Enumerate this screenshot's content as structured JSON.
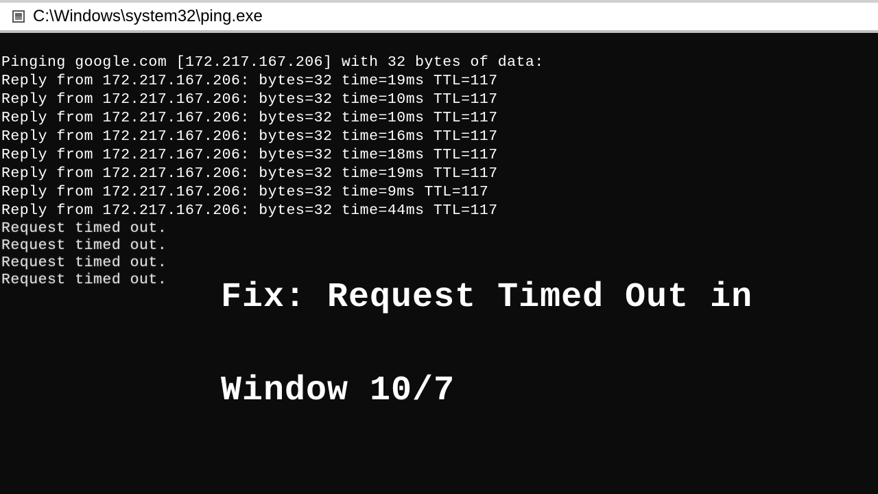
{
  "window": {
    "title": "C:\\Windows\\system32\\ping.exe"
  },
  "terminal": {
    "header": "Pinging google.com [172.217.167.206] with 32 bytes of data:",
    "replies": [
      "Reply from 172.217.167.206: bytes=32 time=19ms TTL=117",
      "Reply from 172.217.167.206: bytes=32 time=10ms TTL=117",
      "Reply from 172.217.167.206: bytes=32 time=10ms TTL=117",
      "Reply from 172.217.167.206: bytes=32 time=16ms TTL=117",
      "Reply from 172.217.167.206: bytes=32 time=18ms TTL=117",
      "Reply from 172.217.167.206: bytes=32 time=19ms TTL=117",
      "Reply from 172.217.167.206: bytes=32 time=9ms TTL=117",
      "Reply from 172.217.167.206: bytes=32 time=44ms TTL=117"
    ],
    "timeouts": [
      "Request timed out.",
      "Request timed out.",
      "Request timed out.",
      "Request timed out."
    ]
  },
  "overlay": {
    "line1": "Fix: Request Timed Out in",
    "line2": "Window 10/7"
  }
}
